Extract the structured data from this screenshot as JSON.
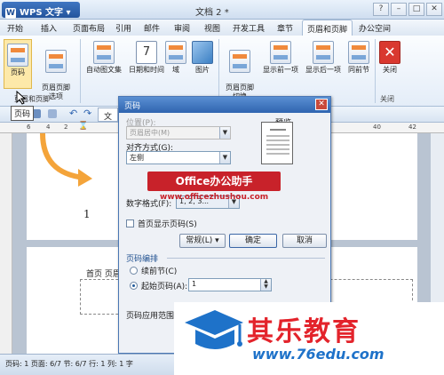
{
  "app": {
    "name": "WPS 文字",
    "doc_title": "文档 2 *"
  },
  "window_controls": [
    "?",
    "–",
    "□",
    "✕"
  ],
  "menu": [
    "开始",
    "插入",
    "页面布局",
    "引用",
    "邮件",
    "审阅",
    "视图",
    "开发工具",
    "章节",
    "页眉和页脚",
    "办公空间"
  ],
  "active_menu": "页眉和页脚",
  "ribbon": {
    "buttons": [
      {
        "label": "页码",
        "icon": "page-number-icon"
      },
      {
        "label": "页眉页脚\n选项",
        "icon": "header-footer-options-icon"
      },
      {
        "label": "自动图文集",
        "icon": "autotext-icon"
      },
      {
        "label": "日期和时间",
        "icon": "calendar-icon",
        "glyph": "7"
      },
      {
        "label": "域",
        "icon": "field-icon"
      },
      {
        "label": "图片",
        "icon": "picture-icon"
      },
      {
        "label": "页眉页脚\n切换",
        "icon": "switch-icon"
      },
      {
        "label": "显示前一项",
        "icon": "show-previous-icon"
      },
      {
        "label": "显示后一项",
        "icon": "show-next-icon"
      },
      {
        "label": "同前节",
        "icon": "link-previous-icon"
      },
      {
        "label": "关闭",
        "icon": "close-icon"
      }
    ],
    "groups": {
      "header_footer": "页眉和页脚",
      "close": "关闭"
    }
  },
  "tooltip": "页码",
  "toolbar_doc_tab": "文",
  "document": {
    "page_number": "1",
    "header_label": "首页 页眉"
  },
  "dialog": {
    "title": "页码",
    "position_label": "位置(P):",
    "position_value": "页眉居中(M)",
    "preview_label": "预览",
    "align_label": "对齐方式(G):",
    "align_value": "左侧",
    "format_label": "数字格式(F):",
    "format_value": "1, 2, 3...",
    "first_page_checkbox": "首页显示页码(S)",
    "btn_normal": "常规(L) ▾",
    "btn_ok": "确定",
    "btn_cancel": "取消",
    "numbering_section": "页码编排",
    "radio_continue": "续前节(C)",
    "radio_start": "起始页码(A):",
    "start_value": "1",
    "apply_label": "页码应用范围(O):"
  },
  "watermark": {
    "title": "Office办公助手",
    "url": "www.officezhushou.com"
  },
  "statusbar": "页码: 1  页面: 6/7  节: 6/7  行: 1  列: 1  字",
  "overlay": {
    "brand": "其乐教育",
    "url": "www.76edu.com"
  },
  "colors": {
    "accent": "#2f64b0",
    "brand_red": "#e3232b",
    "brand_blue": "#1e72c9"
  }
}
